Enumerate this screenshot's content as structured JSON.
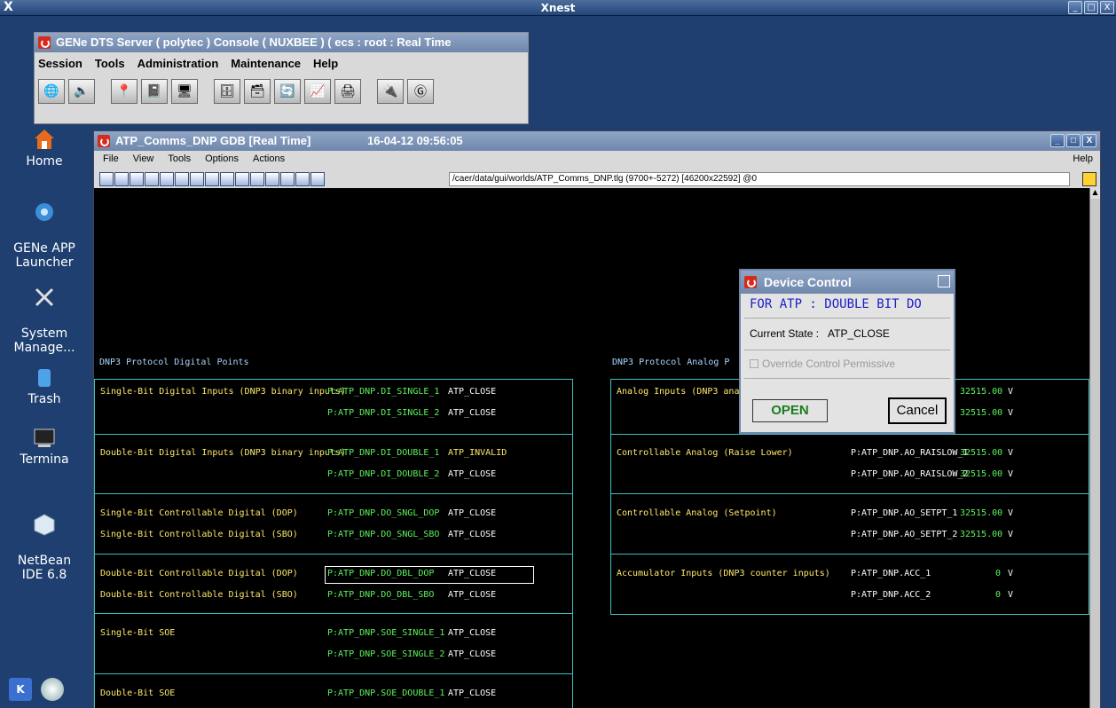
{
  "xnest": {
    "logo": "X",
    "title": "Xnest",
    "min": "_",
    "max": "□",
    "close": "X"
  },
  "desktop": {
    "icons": [
      {
        "label": "Home"
      },
      {
        "label": "GENe APP\nLauncher"
      },
      {
        "label": "System\nManage..."
      },
      {
        "label": "Trash"
      },
      {
        "label": "Termina"
      },
      {
        "label": "NetBean\nIDE 6.8"
      }
    ]
  },
  "console": {
    "title": "GENe DTS Server ( polytec ) Console ( NUXBEE ) ( ecs : root : Real Time",
    "menu": [
      "Session",
      "Tools",
      "Administration",
      "Maintenance",
      "Help"
    ]
  },
  "gdb": {
    "title": "ATP_Comms_DNP  GDB  [Real Time]",
    "timestamp": "16-04-12 09:56:05",
    "menu": [
      "File",
      "View",
      "Tools",
      "Options",
      "Actions"
    ],
    "help": "Help",
    "path": "/caer/data/gui/worlds/ATP_Comms_DNP.tlg (9700+-5272) [46200x22592] @0"
  },
  "digital": {
    "title": "DNP3 Protocol Digital Points",
    "rows": [
      {
        "label1": "Single-Bit Digital Inputs (DNP3 binary inputs)",
        "label2": "",
        "p1": "P:ATP_DNP.DI_SINGLE_1",
        "v1": "ATP_CLOSE",
        "p2": "P:ATP_DNP.DI_SINGLE_2",
        "v2": "ATP_CLOSE"
      },
      {
        "label1": "Double-Bit Digital Inputs (DNP3 binary inputs)",
        "label2": "",
        "p1": "P:ATP_DNP.DI_DOUBLE_1",
        "v1": "ATP_INVALID",
        "p2": "P:ATP_DNP.DI_DOUBLE_2",
        "v2": "ATP_CLOSE"
      },
      {
        "label1": "Single-Bit Controllable Digital (DOP)",
        "label2": "Single-Bit Controllable Digital (SBO)",
        "p1": "P:ATP_DNP.DO_SNGL_DOP",
        "v1": "ATP_CLOSE",
        "p2": "P:ATP_DNP.DO_SNGL_SBO",
        "v2": "ATP_CLOSE"
      },
      {
        "label1": "Double-Bit Controllable Digital (DOP)",
        "label2": "Double-Bit Controllable Digital (SBO)",
        "p1": "P:ATP_DNP.DO_DBL_DOP",
        "v1": "ATP_CLOSE",
        "p2": "P:ATP_DNP.DO_DBL_SBO",
        "v2": "ATP_CLOSE"
      },
      {
        "label1": "Single-Bit SOE",
        "label2": "",
        "p1": "P:ATP_DNP.SOE_SINGLE_1",
        "v1": "ATP_CLOSE",
        "p2": "P:ATP_DNP.SOE_SINGLE_2",
        "v2": "ATP_CLOSE"
      },
      {
        "label1": "Double-Bit SOE",
        "label2": "",
        "p1": "P:ATP_DNP.SOE_DOUBLE_1",
        "v1": "ATP_CLOSE",
        "p2": "",
        "v2": ""
      }
    ]
  },
  "analog": {
    "title": "DNP3 Protocol Analog P",
    "rows": [
      {
        "label": "Analog Inputs (DNP3 analog",
        "p1": "",
        "v1": "32515.00",
        "u1": "V",
        "p2": "",
        "v2": "32515.00",
        "u2": "V"
      },
      {
        "label": "Controllable Analog (Raise Lower)",
        "p1": "P:ATP_DNP.AO_RAISLOW_1",
        "v1": "32515.00",
        "u1": "V",
        "p2": "P:ATP_DNP.AO_RAISLOW_2",
        "v2": "32515.00",
        "u2": "V"
      },
      {
        "label": "Controllable Analog (Setpoint)",
        "p1": "P:ATP_DNP.AO_SETPT_1",
        "v1": "32515.00",
        "u1": "V",
        "p2": "P:ATP_DNP.AO_SETPT_2",
        "v2": "32515.00",
        "u2": "V"
      },
      {
        "label": "Accumulator Inputs (DNP3 counter inputs)",
        "p1": "P:ATP_DNP.ACC_1",
        "v1": "0",
        "u1": "V",
        "p2": "P:ATP_DNP.ACC_2",
        "v2": "0",
        "u2": "V"
      }
    ]
  },
  "dialog": {
    "title": "Device Control",
    "header": "FOR ATP : DOUBLE BIT DO",
    "state_label": "Current State :",
    "state_value": "ATP_CLOSE",
    "override_label": "Override Control Permissive",
    "open_label": "OPEN",
    "cancel_label": "Cancel"
  },
  "colors": {
    "accent": "#6f87ab",
    "point_green": "#5cf25c",
    "label_yellow": "#ffe86a",
    "border_cyan": "#3fbfbf"
  }
}
